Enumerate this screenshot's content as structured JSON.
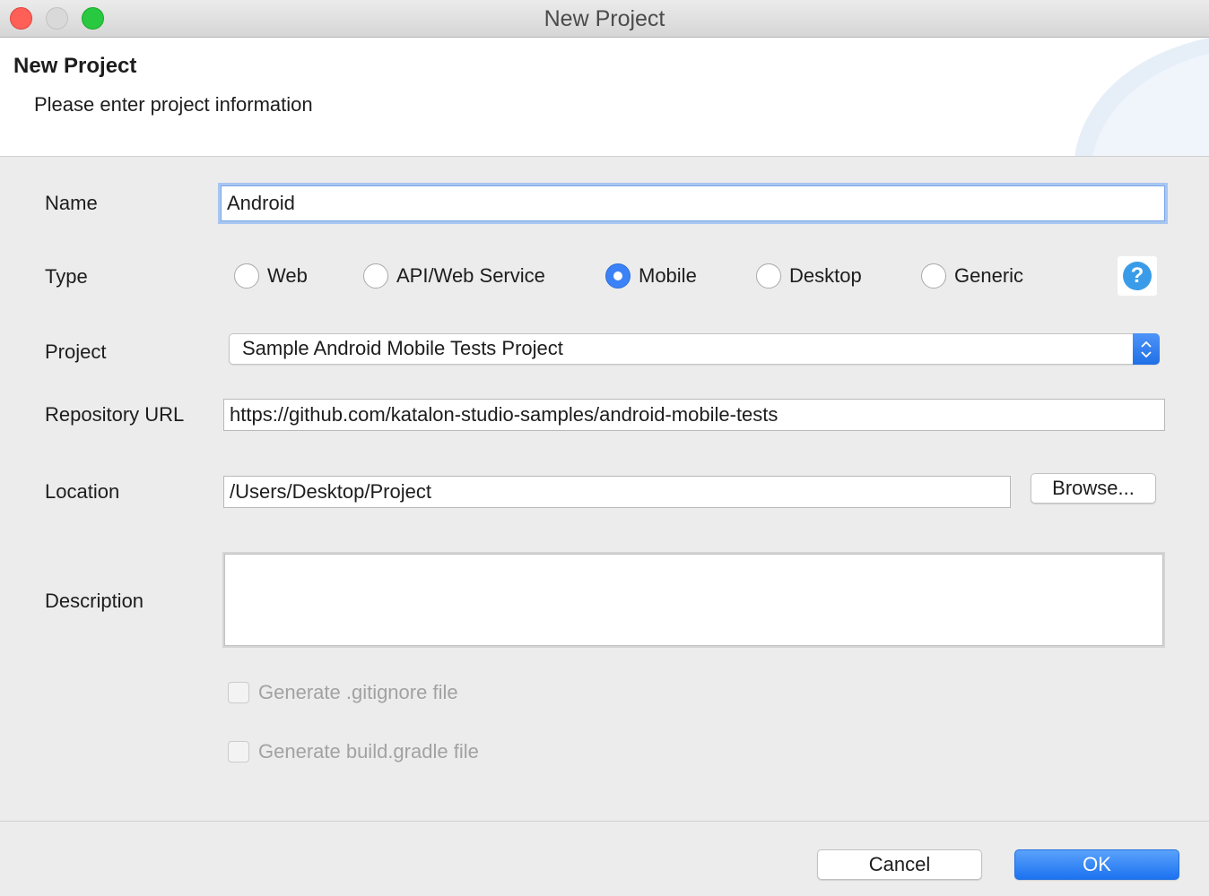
{
  "window": {
    "title": "New Project"
  },
  "header": {
    "title": "New Project",
    "subtitle": "Please enter project information"
  },
  "form": {
    "name": {
      "label": "Name",
      "value": "Android"
    },
    "type": {
      "label": "Type",
      "options": [
        "Web",
        "API/Web Service",
        "Mobile",
        "Desktop",
        "Generic"
      ],
      "selected": "Mobile"
    },
    "project": {
      "label": "Project",
      "value": "Sample Android Mobile Tests Project"
    },
    "repository_url": {
      "label": "Repository URL",
      "value": "https://github.com/katalon-studio-samples/android-mobile-tests"
    },
    "location": {
      "label": "Location",
      "value": "/Users/Desktop/Project",
      "browse_label": "Browse..."
    },
    "description": {
      "label": "Description",
      "value": ""
    },
    "generate_gitignore": {
      "label": "Generate .gitignore file",
      "checked": false,
      "disabled": true
    },
    "generate_build_gradle": {
      "label": "Generate build.gradle file",
      "checked": false,
      "disabled": true
    }
  },
  "help": {
    "glyph": "?",
    "icon": "help-icon"
  },
  "footer": {
    "cancel_label": "Cancel",
    "ok_label": "OK"
  },
  "colors": {
    "accent": "#3b82f6",
    "close": "#fe5f57",
    "minimize": "#d9d9d9",
    "maximize": "#28c840",
    "help": "#3a9ce8"
  }
}
